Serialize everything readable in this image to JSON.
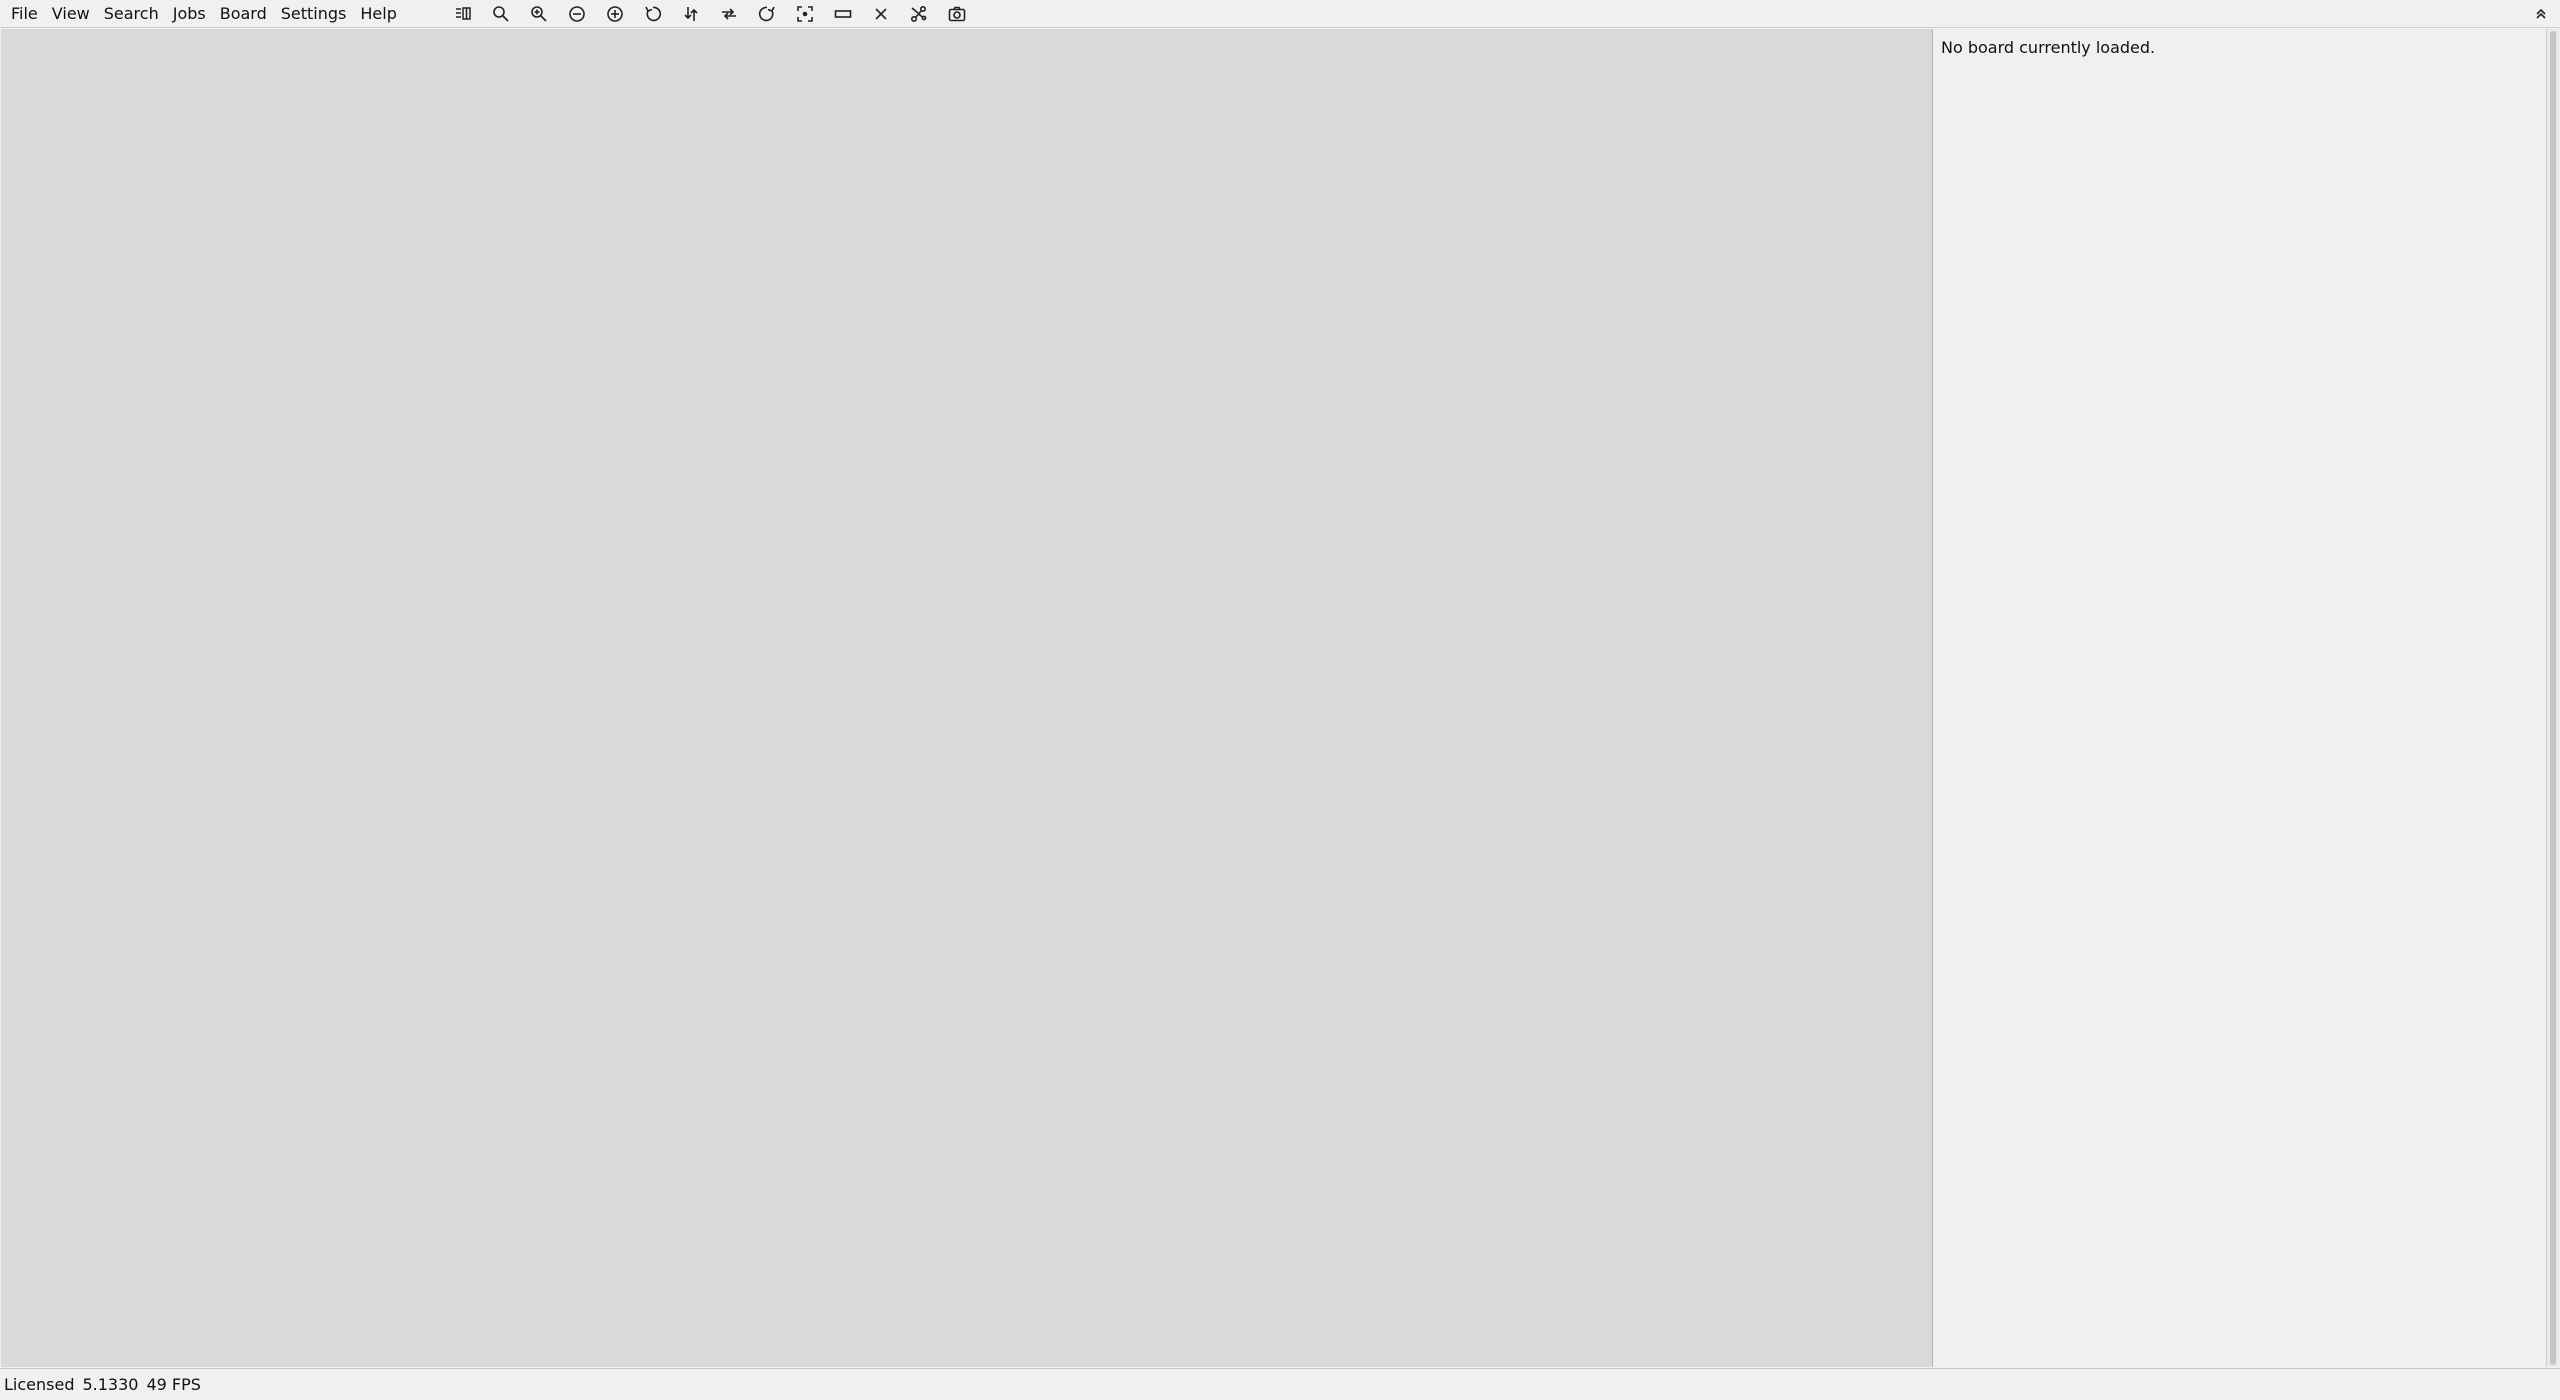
{
  "menubar": {
    "items": [
      "File",
      "View",
      "Search",
      "Jobs",
      "Board",
      "Settings",
      "Help"
    ]
  },
  "toolbar": {
    "buttons": [
      "panel-layout-icon",
      "zoom-icon",
      "zoom-in-icon",
      "zoom-out-circle-icon",
      "zoom-in-circle-icon",
      "rotate-left-icon",
      "flip-vertical-icon",
      "flip-horizontal-icon",
      "rotate-right-icon",
      "fit-to-screen-icon",
      "board-outline-icon",
      "close-icon",
      "net-tool-icon",
      "camera-icon"
    ]
  },
  "side_panel": {
    "message": "No board currently loaded."
  },
  "statusbar": {
    "license": "Licensed",
    "version": "5.1330",
    "fps": "49 FPS"
  },
  "colors": {
    "canvas_bg": "#d9d9d9",
    "panel_bg": "#f0f0f0",
    "text": "#111111"
  }
}
